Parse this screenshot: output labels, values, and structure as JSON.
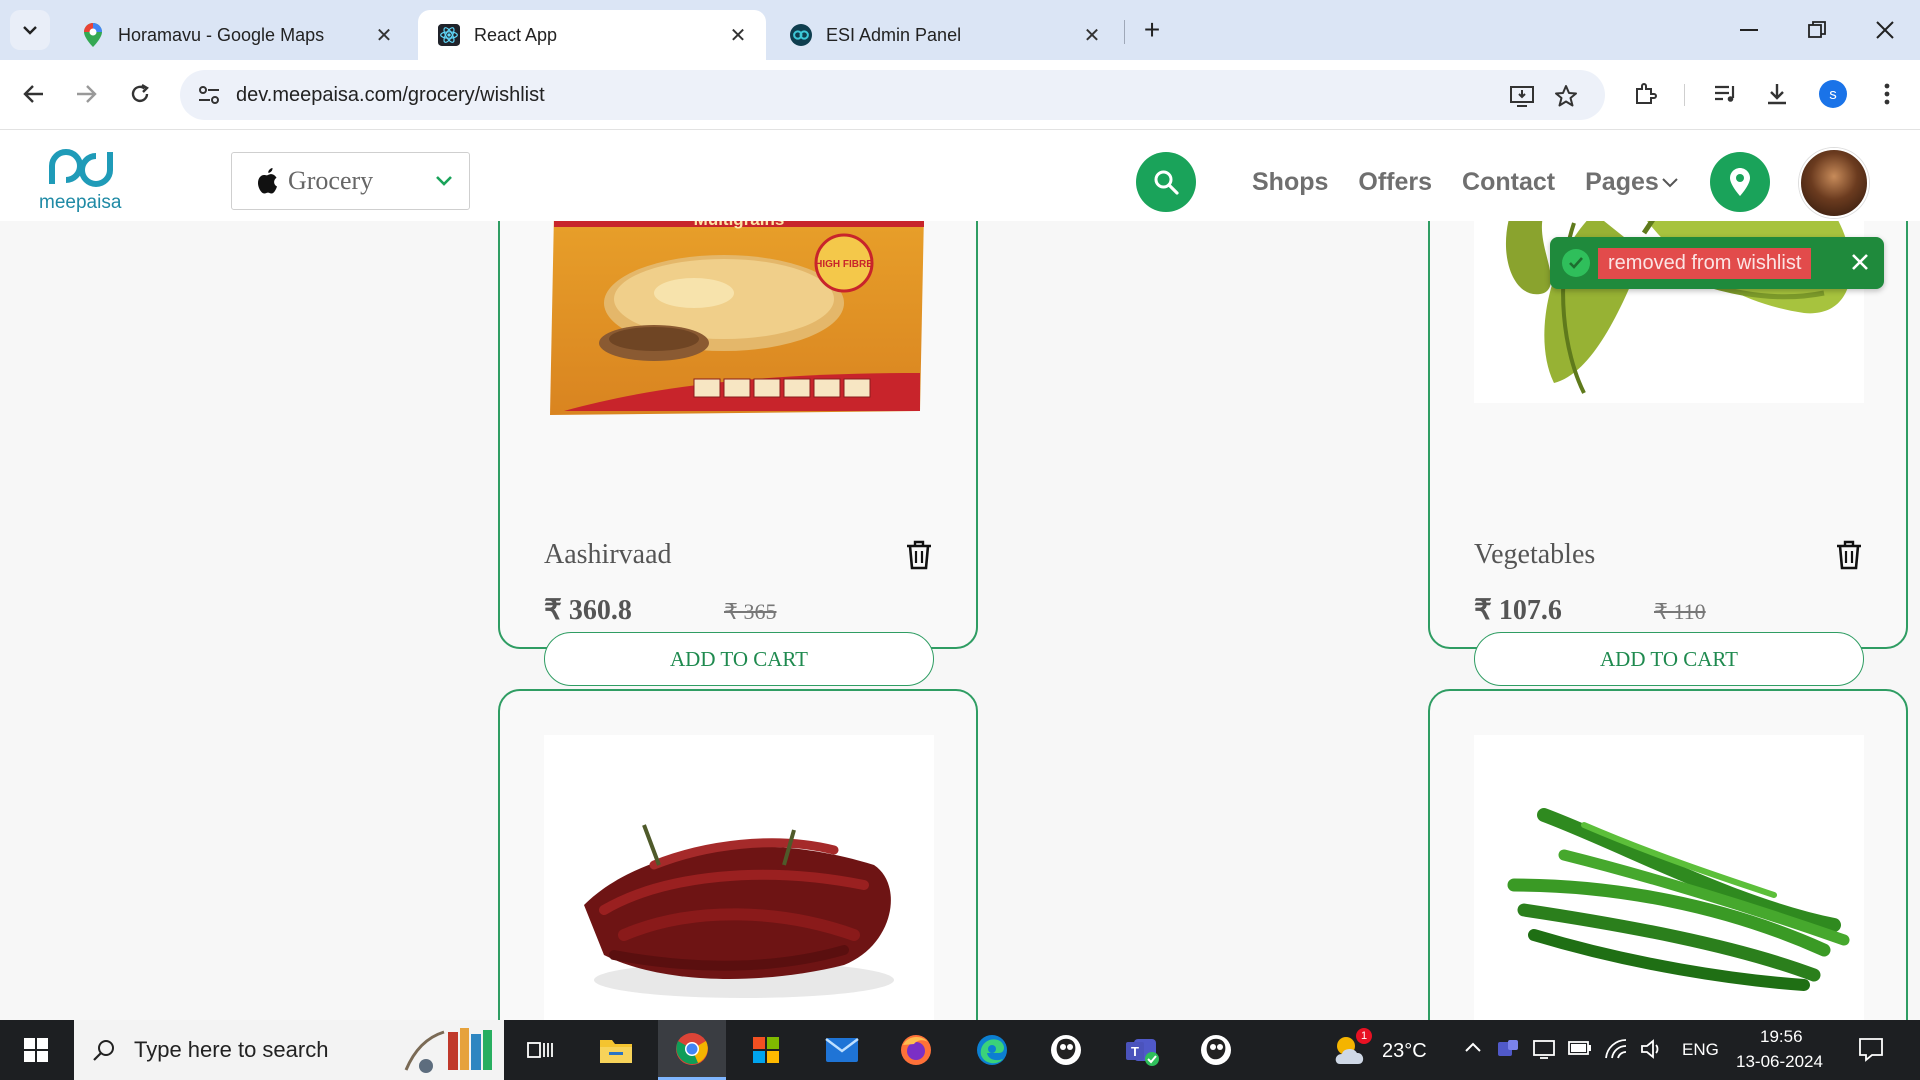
{
  "browser": {
    "tabs": [
      {
        "title": "Horamavu - Google Maps",
        "active": false
      },
      {
        "title": "React App",
        "active": true
      },
      {
        "title": "ESI Admin Panel",
        "active": false
      }
    ],
    "url": "dev.meepaisa.com/grocery/wishlist",
    "profile_initial": "s"
  },
  "header": {
    "logo_text": "meepaisa",
    "category": "Grocery",
    "nav": [
      "Shops",
      "Offers",
      "Contact",
      "Pages"
    ]
  },
  "products": [
    {
      "name": "Aashirvaad",
      "price": "₹ 360.8",
      "mrp": "₹ 365",
      "button": "ADD TO CART",
      "package_text": "Multigrains",
      "badge": "HIGH FIBRE"
    },
    {
      "name": "Vegetables",
      "price": "₹ 107.6",
      "mrp": "₹ 110",
      "button": "ADD TO CART"
    },
    {
      "name": "",
      "price": "",
      "mrp": "",
      "button": ""
    },
    {
      "name": "",
      "price": "",
      "mrp": "",
      "button": ""
    }
  ],
  "toast": {
    "message": "removed from wishlist"
  },
  "taskbar": {
    "search_placeholder": "Type here to search",
    "weather": "23°C",
    "weather_badge": "1",
    "language": "ENG",
    "time": "19:56",
    "date": "13-06-2024"
  },
  "colors": {
    "brand_green": "#1aa35a",
    "card_border": "#2f9d63",
    "toast_bg": "#1f8a3c",
    "toast_msg": "#e24b4b"
  }
}
